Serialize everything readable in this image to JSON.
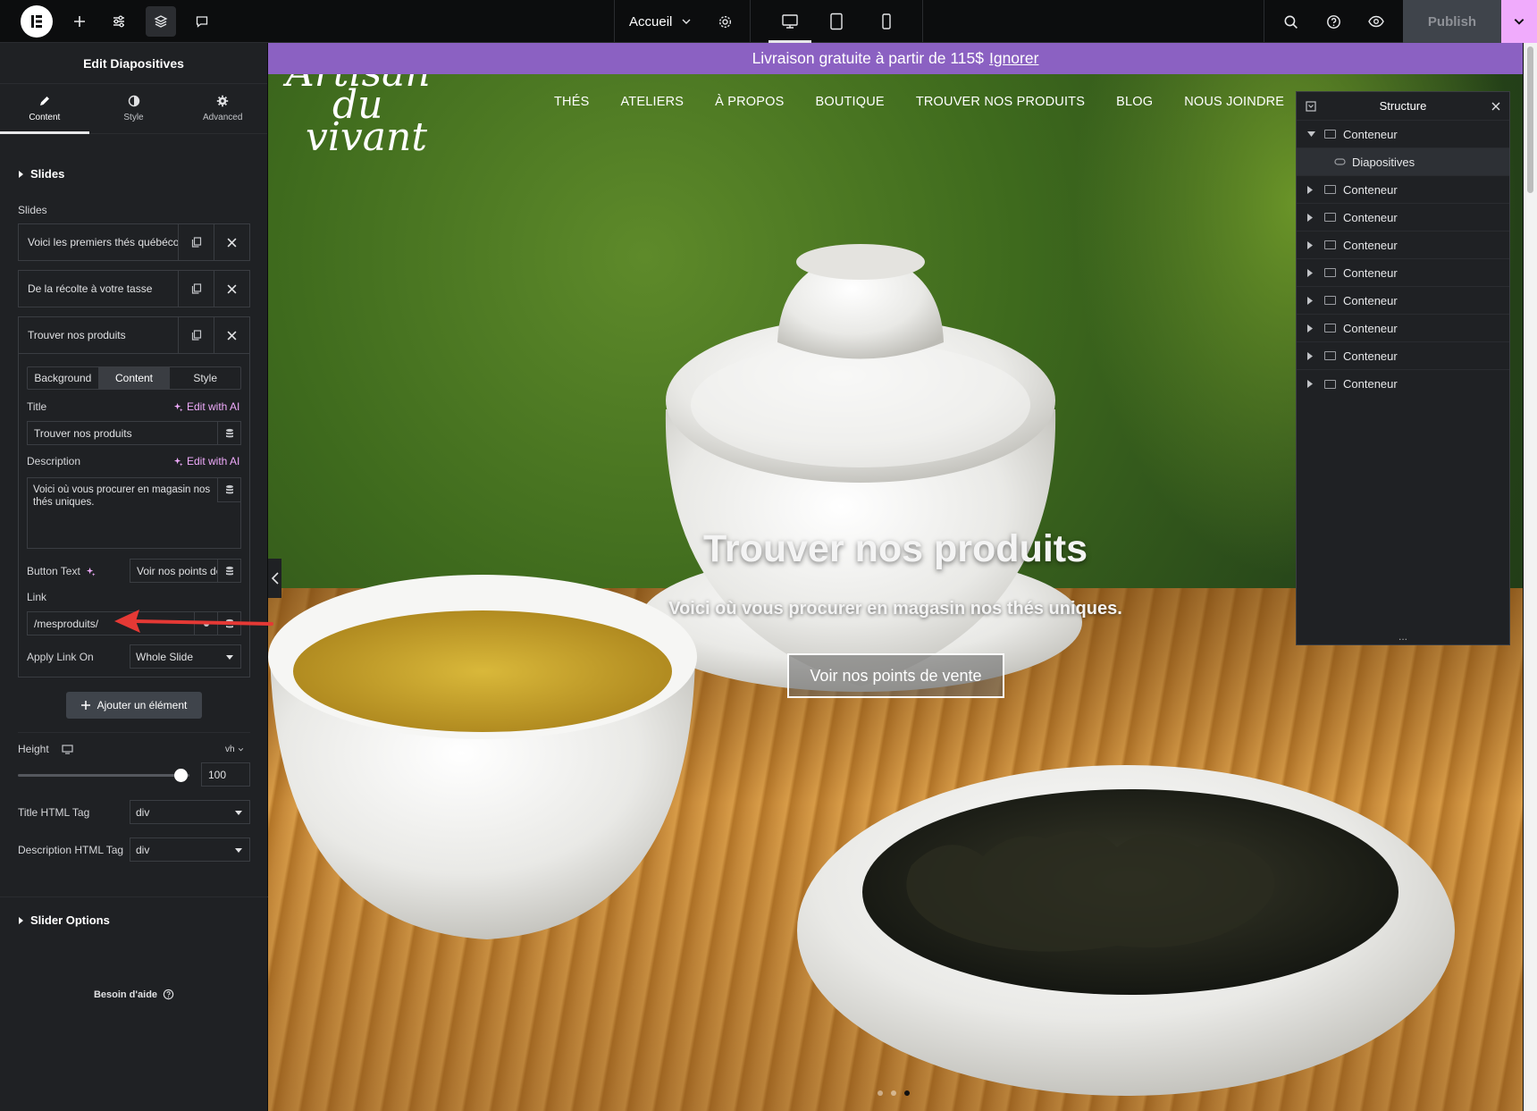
{
  "topbar": {
    "page_name": "Accueil",
    "publish_label": "Publish"
  },
  "panel": {
    "title": "Edit Diapositives",
    "tabs": [
      {
        "label": "Content",
        "icon": "pencil-icon"
      },
      {
        "label": "Style",
        "icon": "half-circle-icon"
      },
      {
        "label": "Advanced",
        "icon": "gear-icon"
      }
    ],
    "section_slides": "Slides",
    "slides_label": "Slides",
    "slides": [
      {
        "title": "Voici les premiers thés québécois"
      },
      {
        "title": "De la récolte à votre tasse"
      },
      {
        "title": "Trouver nos produits"
      }
    ],
    "subtabs": [
      "Background",
      "Content",
      "Style"
    ],
    "title_label": "Title",
    "edit_ai": "Edit with AI",
    "title_value": "Trouver nos produits",
    "description_label": "Description",
    "description_value": "Voici où vous procurer en magasin nos thés uniques.",
    "button_text_label": "Button Text",
    "button_text_value": "Voir nos points de vente",
    "link_label": "Link",
    "link_value": "/mesproduits/",
    "apply_link_label": "Apply Link On",
    "apply_link_value": "Whole Slide",
    "add_item": "Ajouter un élément",
    "height_label": "Height",
    "height_unit": "vh",
    "height_value": "100",
    "height_fraction": 0.95,
    "title_tag_label": "Title HTML Tag",
    "title_tag_value": "div",
    "desc_tag_label": "Description HTML Tag",
    "desc_tag_value": "div",
    "slider_options": "Slider Options",
    "help": "Besoin d'aide"
  },
  "site": {
    "promo_text": "Livraison gratuite à partir de 115$",
    "promo_link": "Ignorer",
    "logo_lines": [
      "Artisan",
      "du",
      "vivant"
    ],
    "nav": [
      "THÉS",
      "ATELIERS",
      "À PROPOS",
      "BOUTIQUE",
      "TROUVER NOS PRODUITS",
      "BLOG",
      "NOUS JOINDRE"
    ],
    "hero_title": "Trouver nos produits",
    "hero_desc": "Voici où vous procurer en magasin nos thés uniques.",
    "hero_button": "Voir nos points de vente"
  },
  "structure": {
    "title": "Structure",
    "items": [
      {
        "label": "Conteneur",
        "expanded": true
      },
      {
        "label": "Diapositives",
        "child": true,
        "selected": true
      },
      {
        "label": "Conteneur"
      },
      {
        "label": "Conteneur"
      },
      {
        "label": "Conteneur"
      },
      {
        "label": "Conteneur"
      },
      {
        "label": "Conteneur"
      },
      {
        "label": "Conteneur"
      },
      {
        "label": "Conteneur"
      },
      {
        "label": "Conteneur"
      }
    ],
    "more": "..."
  },
  "colors": {
    "accent_pink": "#f0abfc",
    "promo_purple": "#8b61c2",
    "annotation_red": "#e53935"
  }
}
